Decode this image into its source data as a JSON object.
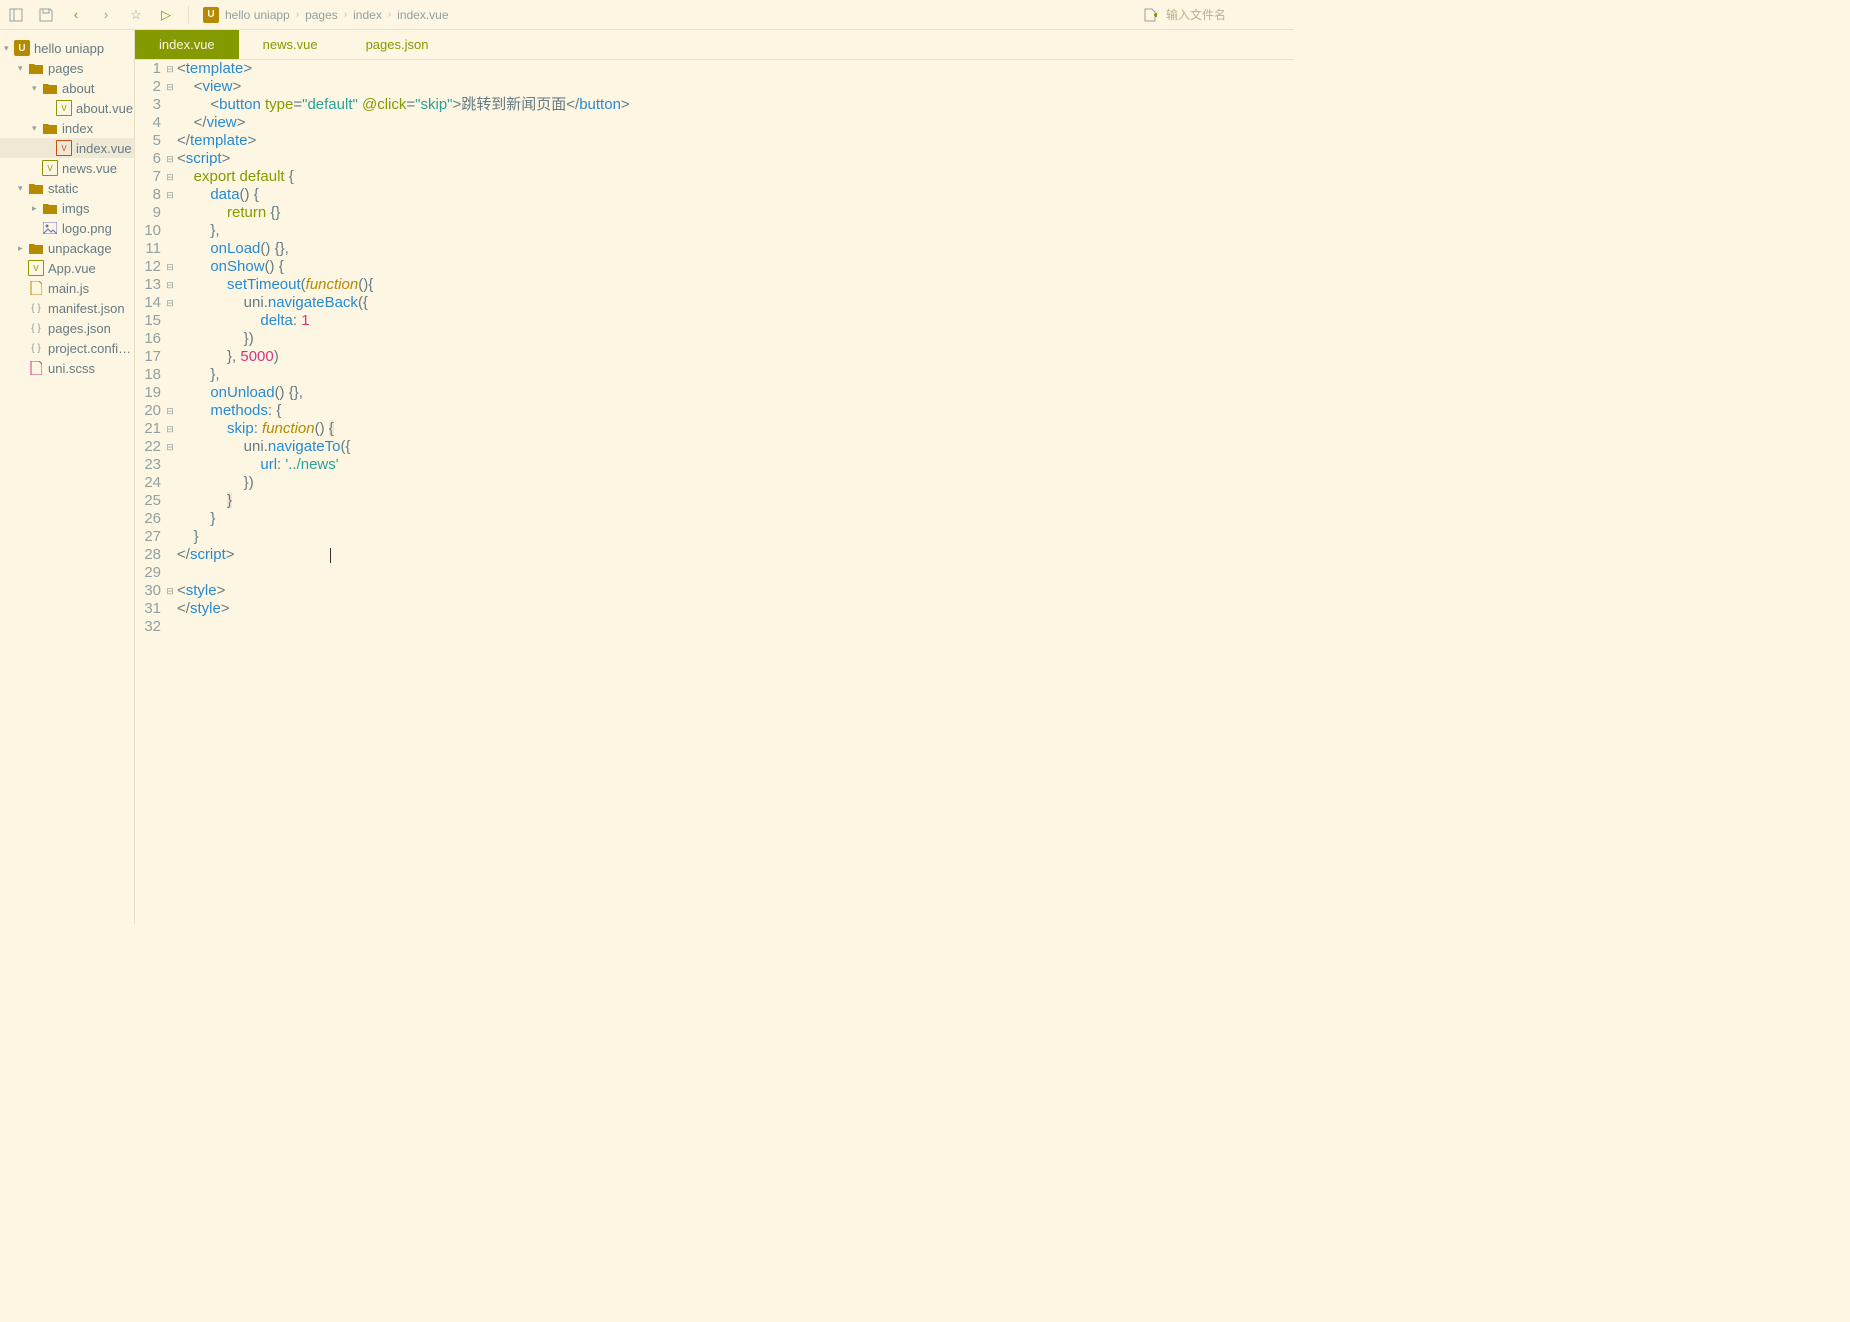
{
  "toolbar": {
    "search_placeholder": "输入文件名"
  },
  "breadcrumb": [
    "hello uniapp",
    "pages",
    "index",
    "index.vue"
  ],
  "sidebar": {
    "root": "hello uniapp",
    "tree": [
      {
        "label": "pages",
        "icon": "folder",
        "depth": 1,
        "arrow": "v"
      },
      {
        "label": "about",
        "icon": "folder",
        "depth": 2,
        "arrow": "v"
      },
      {
        "label": "about.vue",
        "icon": "vue",
        "depth": 3,
        "arrow": ""
      },
      {
        "label": "index",
        "icon": "folder",
        "depth": 2,
        "arrow": "v"
      },
      {
        "label": "index.vue",
        "icon": "vue-sel",
        "depth": 3,
        "arrow": "",
        "selected": true
      },
      {
        "label": "news.vue",
        "icon": "vue",
        "depth": 2,
        "arrow": ""
      },
      {
        "label": "static",
        "icon": "folder",
        "depth": 1,
        "arrow": "v"
      },
      {
        "label": "imgs",
        "icon": "folder",
        "depth": 2,
        "arrow": ">"
      },
      {
        "label": "logo.png",
        "icon": "img",
        "depth": 2,
        "arrow": ""
      },
      {
        "label": "unpackage",
        "icon": "folder",
        "depth": 1,
        "arrow": ">"
      },
      {
        "label": "App.vue",
        "icon": "vue",
        "depth": 1,
        "arrow": ""
      },
      {
        "label": "main.js",
        "icon": "js",
        "depth": 1,
        "arrow": ""
      },
      {
        "label": "manifest.json",
        "icon": "json-braces",
        "depth": 1,
        "arrow": ""
      },
      {
        "label": "pages.json",
        "icon": "json-braces",
        "depth": 1,
        "arrow": ""
      },
      {
        "label": "project.config....",
        "icon": "json-braces",
        "depth": 1,
        "arrow": ""
      },
      {
        "label": "uni.scss",
        "icon": "scss",
        "depth": 1,
        "arrow": ""
      }
    ]
  },
  "tabs": [
    {
      "label": "index.vue",
      "active": true
    },
    {
      "label": "news.vue",
      "active": false
    },
    {
      "label": "pages.json",
      "active": false
    }
  ],
  "code": {
    "lines": [
      {
        "n": 1,
        "fold": "⊟",
        "tokens": [
          [
            "t-punct",
            "<"
          ],
          [
            "t-tag",
            "template"
          ],
          [
            "t-punct",
            ">"
          ]
        ]
      },
      {
        "n": 2,
        "fold": "⊟",
        "tokens": [
          [
            "t-plain",
            "    "
          ],
          [
            "t-punct",
            "<"
          ],
          [
            "t-tag",
            "view"
          ],
          [
            "t-punct",
            ">"
          ]
        ]
      },
      {
        "n": 3,
        "fold": "",
        "tokens": [
          [
            "t-plain",
            "        "
          ],
          [
            "t-punct",
            "<"
          ],
          [
            "t-tag",
            "button"
          ],
          [
            "t-plain",
            " "
          ],
          [
            "t-attr",
            "type"
          ],
          [
            "t-punct",
            "="
          ],
          [
            "t-str",
            "\"default\""
          ],
          [
            "t-plain",
            " "
          ],
          [
            "t-attr",
            "@click"
          ],
          [
            "t-punct",
            "="
          ],
          [
            "t-str",
            "\"skip\""
          ],
          [
            "t-punct",
            ">"
          ],
          [
            "t-plain",
            "跳转到新闻页面"
          ],
          [
            "t-punct",
            "</"
          ],
          [
            "t-tag",
            "button"
          ],
          [
            "t-punct",
            ">"
          ]
        ]
      },
      {
        "n": 4,
        "fold": "",
        "tokens": [
          [
            "t-plain",
            "    "
          ],
          [
            "t-punct",
            "</"
          ],
          [
            "t-tag",
            "view"
          ],
          [
            "t-punct",
            ">"
          ]
        ]
      },
      {
        "n": 5,
        "fold": "",
        "tokens": [
          [
            "t-punct",
            "</"
          ],
          [
            "t-tag",
            "template"
          ],
          [
            "t-punct",
            ">"
          ]
        ]
      },
      {
        "n": 6,
        "fold": "⊟",
        "tokens": [
          [
            "t-punct",
            "<"
          ],
          [
            "t-tag",
            "script"
          ],
          [
            "t-punct",
            ">"
          ]
        ]
      },
      {
        "n": 7,
        "fold": "⊟",
        "tokens": [
          [
            "t-plain",
            "    "
          ],
          [
            "t-kw",
            "export default"
          ],
          [
            "t-plain",
            " {"
          ]
        ]
      },
      {
        "n": 8,
        "fold": "⊟",
        "tokens": [
          [
            "t-plain",
            "        "
          ],
          [
            "t-fn",
            "data"
          ],
          [
            "t-punct",
            "() {"
          ]
        ]
      },
      {
        "n": 9,
        "fold": "",
        "tokens": [
          [
            "t-plain",
            "            "
          ],
          [
            "t-kw",
            "return"
          ],
          [
            "t-plain",
            " {}"
          ]
        ]
      },
      {
        "n": 10,
        "fold": "",
        "tokens": [
          [
            "t-plain",
            "        },"
          ]
        ]
      },
      {
        "n": 11,
        "fold": "",
        "tokens": [
          [
            "t-plain",
            "        "
          ],
          [
            "t-fn",
            "onLoad"
          ],
          [
            "t-punct",
            "() {},"
          ]
        ]
      },
      {
        "n": 12,
        "fold": "⊟",
        "tokens": [
          [
            "t-plain",
            "        "
          ],
          [
            "t-fn",
            "onShow"
          ],
          [
            "t-punct",
            "() {"
          ]
        ]
      },
      {
        "n": 13,
        "fold": "⊟",
        "tokens": [
          [
            "t-plain",
            "            "
          ],
          [
            "t-fn",
            "setTimeout"
          ],
          [
            "t-punct",
            "("
          ],
          [
            "t-fnname",
            "function"
          ],
          [
            "t-punct",
            "(){"
          ]
        ]
      },
      {
        "n": 14,
        "fold": "⊟",
        "tokens": [
          [
            "t-plain",
            "                uni."
          ],
          [
            "t-fn",
            "navigateBack"
          ],
          [
            "t-punct",
            "({"
          ]
        ]
      },
      {
        "n": 15,
        "fold": "",
        "tokens": [
          [
            "t-plain",
            "                    "
          ],
          [
            "t-key",
            "delta"
          ],
          [
            "t-punct",
            ": "
          ],
          [
            "t-num",
            "1"
          ]
        ]
      },
      {
        "n": 16,
        "fold": "",
        "tokens": [
          [
            "t-plain",
            "                })"
          ]
        ]
      },
      {
        "n": 17,
        "fold": "",
        "tokens": [
          [
            "t-plain",
            "            }, "
          ],
          [
            "t-num",
            "5000"
          ],
          [
            "t-punct",
            ")"
          ]
        ]
      },
      {
        "n": 18,
        "fold": "",
        "tokens": [
          [
            "t-plain",
            "        },"
          ]
        ]
      },
      {
        "n": 19,
        "fold": "",
        "tokens": [
          [
            "t-plain",
            "        "
          ],
          [
            "t-fn",
            "onUnload"
          ],
          [
            "t-punct",
            "() {},"
          ]
        ]
      },
      {
        "n": 20,
        "fold": "⊟",
        "tokens": [
          [
            "t-plain",
            "        "
          ],
          [
            "t-key",
            "methods"
          ],
          [
            "t-punct",
            ": {"
          ]
        ]
      },
      {
        "n": 21,
        "fold": "⊟",
        "tokens": [
          [
            "t-plain",
            "            "
          ],
          [
            "t-key",
            "skip"
          ],
          [
            "t-punct",
            ": "
          ],
          [
            "t-fnname",
            "function"
          ],
          [
            "t-punct",
            "() "
          ],
          [
            "t-bracket",
            "{"
          ]
        ]
      },
      {
        "n": 22,
        "fold": "⊟",
        "tokens": [
          [
            "t-plain",
            "                uni."
          ],
          [
            "t-fn",
            "navigateTo"
          ],
          [
            "t-punct",
            "({"
          ]
        ]
      },
      {
        "n": 23,
        "fold": "",
        "tokens": [
          [
            "t-plain",
            "                    "
          ],
          [
            "t-key",
            "url"
          ],
          [
            "t-punct",
            ": "
          ],
          [
            "t-str",
            "'../news'"
          ]
        ]
      },
      {
        "n": 24,
        "fold": "",
        "tokens": [
          [
            "t-plain",
            "                })"
          ]
        ]
      },
      {
        "n": 25,
        "fold": "",
        "tokens": [
          [
            "t-plain",
            "            "
          ],
          [
            "t-bracket",
            "}"
          ]
        ]
      },
      {
        "n": 26,
        "fold": "",
        "tokens": [
          [
            "t-plain",
            "        }"
          ]
        ]
      },
      {
        "n": 27,
        "fold": "",
        "tokens": [
          [
            "t-plain",
            "    }"
          ]
        ]
      },
      {
        "n": 28,
        "fold": "",
        "tokens": [
          [
            "t-punct",
            "</"
          ],
          [
            "t-tag",
            "script"
          ],
          [
            "t-punct",
            ">"
          ],
          [
            "cursor",
            ""
          ]
        ]
      },
      {
        "n": 29,
        "fold": "",
        "tokens": []
      },
      {
        "n": 30,
        "fold": "⊟",
        "tokens": [
          [
            "t-punct",
            "<"
          ],
          [
            "t-tag",
            "style"
          ],
          [
            "t-punct",
            ">"
          ]
        ]
      },
      {
        "n": 31,
        "fold": "",
        "tokens": [
          [
            "t-punct",
            "</"
          ],
          [
            "t-tag",
            "style"
          ],
          [
            "t-punct",
            ">"
          ]
        ]
      },
      {
        "n": 32,
        "fold": "",
        "tokens": []
      }
    ]
  }
}
